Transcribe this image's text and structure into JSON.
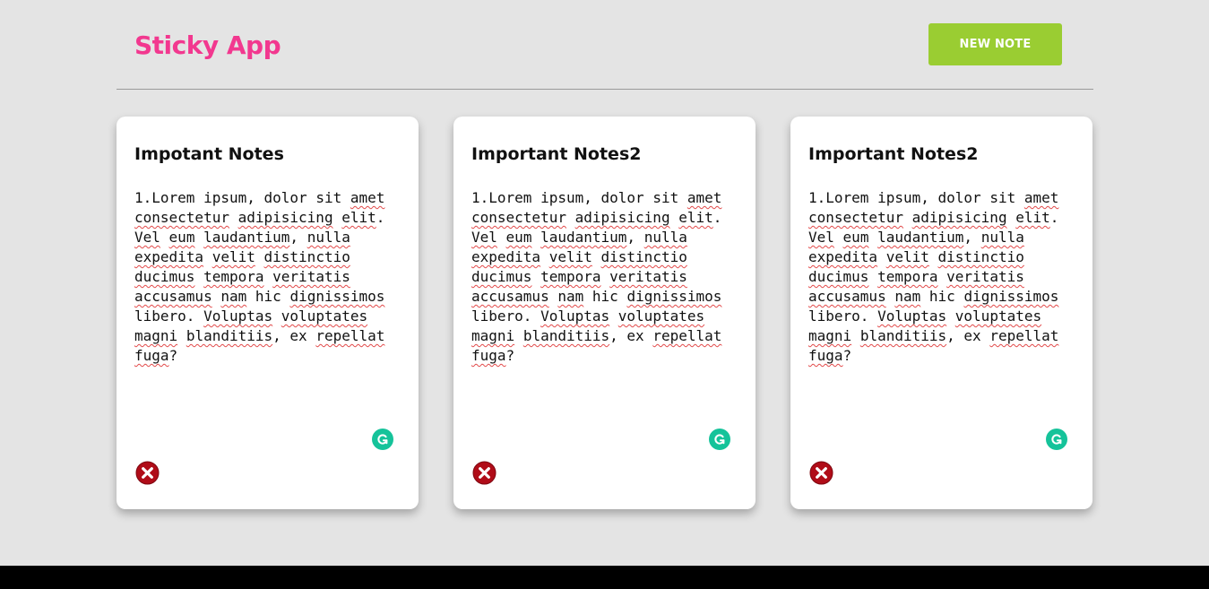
{
  "header": {
    "title": "Sticky App",
    "new_note_label": "NEW NOTE"
  },
  "colors": {
    "title": "#f2388f",
    "button": "#9acd32",
    "background": "#e4e4e4",
    "delete_icon": "#b00c18",
    "grammarly_icon": "#15c39a"
  },
  "notes": [
    {
      "title": "Impotant Notes",
      "body": "1.Lorem ipsum, dolor sit amet consectetur adipisicing elit. Vel eum laudantium, nulla expedita velit distinctio ducimus tempora veritatis accusamus nam hic dignissimos libero. Voluptas voluptates magni blanditiis, ex repellat fuga?"
    },
    {
      "title": "Important Notes2",
      "body": "1.Lorem ipsum, dolor sit amet consectetur adipisicing elit. Vel eum laudantium, nulla expedita velit distinctio ducimus tempora veritatis accusamus nam hic dignissimos libero. Voluptas voluptates magni blanditiis, ex repellat fuga?"
    },
    {
      "title": "Important Notes2",
      "body": "1.Lorem ipsum, dolor sit amet consectetur adipisicing elit. Vel eum laudantium, nulla expedita velit distinctio ducimus tempora veritatis accusamus nam hic dignissimos libero. Voluptas voluptates magni blanditiis, ex repellat fuga?"
    }
  ],
  "icons": {
    "delete": "delete-circle-x-icon",
    "grammarly": "grammarly-g-icon"
  }
}
